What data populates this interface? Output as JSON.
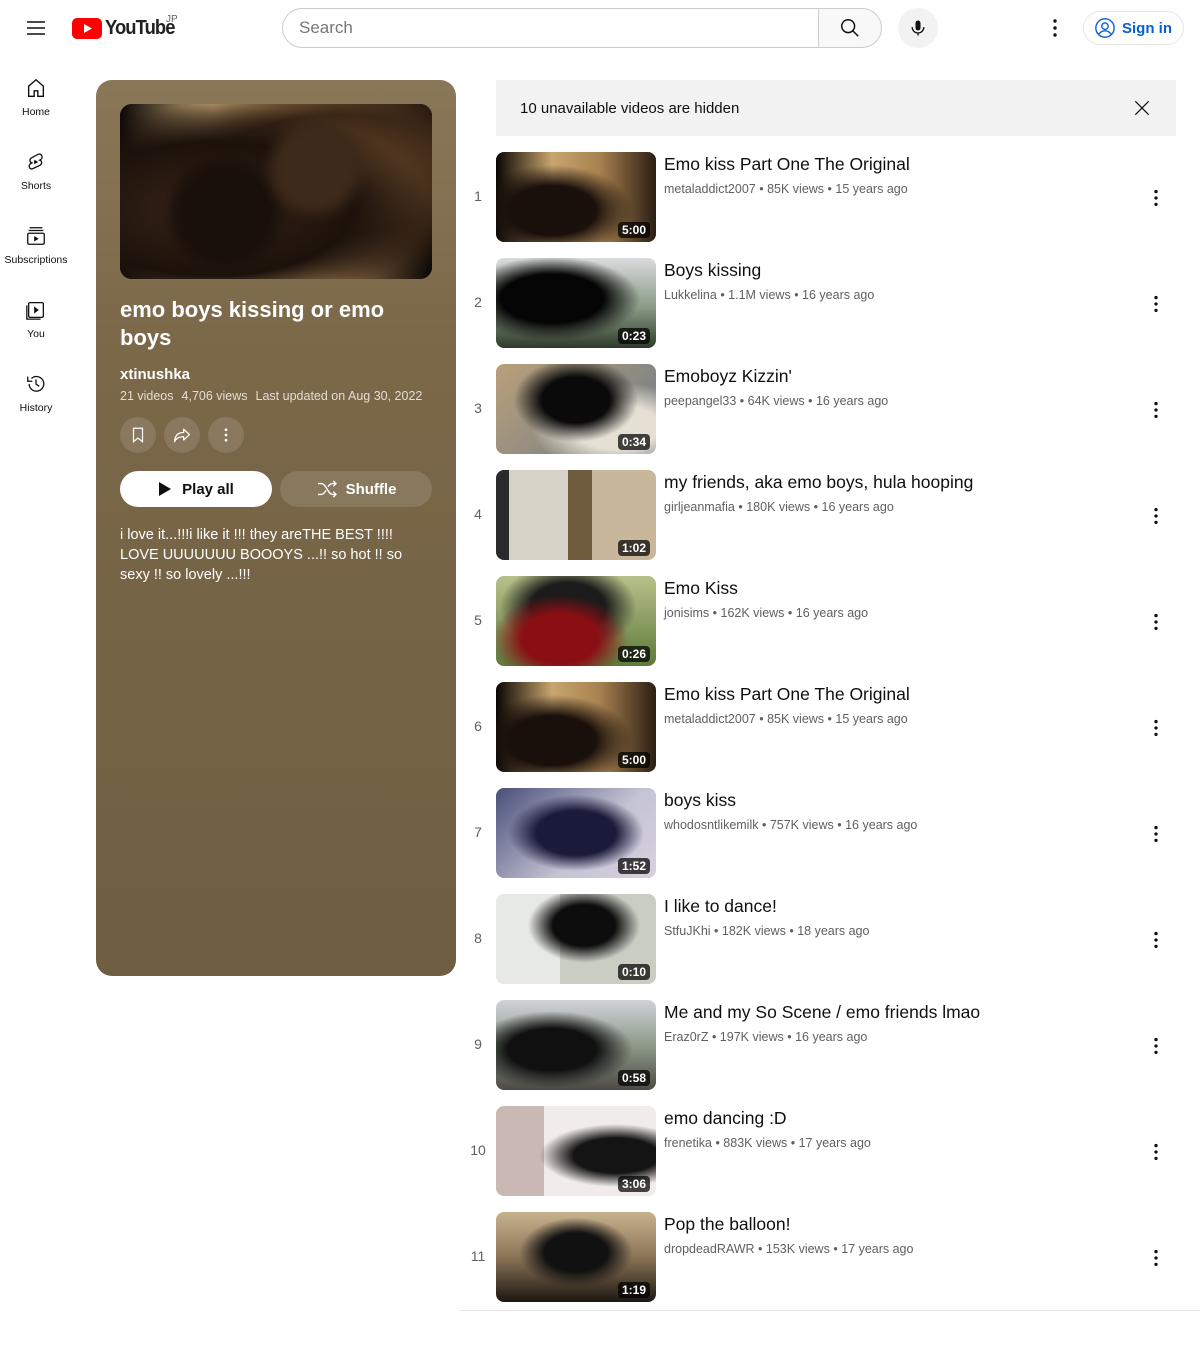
{
  "header": {
    "logo_text": "YouTube",
    "region": "JP",
    "search_placeholder": "Search",
    "signin_label": "Sign in"
  },
  "guide": {
    "items": [
      {
        "label": "Home",
        "icon": "home-icon"
      },
      {
        "label": "Shorts",
        "icon": "shorts-icon"
      },
      {
        "label": "Subscriptions",
        "icon": "subscriptions-icon"
      },
      {
        "label": "You",
        "icon": "you-icon"
      },
      {
        "label": "History",
        "icon": "history-icon"
      }
    ]
  },
  "playlist": {
    "title": "emo boys kissing or emo boys",
    "owner": "xtinushka",
    "video_count": "21 videos",
    "views": "4,706 views",
    "updated": "Last updated on Aug 30, 2022",
    "play_all_label": "Play all",
    "shuffle_label": "Shuffle",
    "description": "i love it...!!!i like it !!! they areTHE BEST !!!! LOVE UUUUUUU BOOOYS ...!! so hot !! so sexy !! so lovely ...!!!",
    "colors": {
      "card_top": "#8a7758",
      "card_bottom": "#6f5e42"
    }
  },
  "alert": {
    "text": "10 unavailable videos are hidden"
  },
  "videos": [
    {
      "index": "1",
      "title": "Emo kiss Part One The Original",
      "channel": "metaladdict2007",
      "views": "85K views",
      "age": "15 years ago",
      "duration": "5:00"
    },
    {
      "index": "2",
      "title": "Boys kissing",
      "channel": "Lukkelina",
      "views": "1.1M views",
      "age": "16 years ago",
      "duration": "0:23"
    },
    {
      "index": "3",
      "title": "Emoboyz Kizzin'",
      "channel": "peepangel33",
      "views": "64K views",
      "age": "16 years ago",
      "duration": "0:34"
    },
    {
      "index": "4",
      "title": "my friends, aka emo boys, hula hooping",
      "channel": "girljeanmafia",
      "views": "180K views",
      "age": "16 years ago",
      "duration": "1:02"
    },
    {
      "index": "5",
      "title": "Emo Kiss",
      "channel": "jonisims",
      "views": "162K views",
      "age": "16 years ago",
      "duration": "0:26"
    },
    {
      "index": "6",
      "title": "Emo kiss Part One The Original",
      "channel": "metaladdict2007",
      "views": "85K views",
      "age": "15 years ago",
      "duration": "5:00"
    },
    {
      "index": "7",
      "title": "boys kiss",
      "channel": "whodosntlikemilk",
      "views": "757K views",
      "age": "16 years ago",
      "duration": "1:52"
    },
    {
      "index": "8",
      "title": "I like to dance!",
      "channel": "StfuJKhi",
      "views": "182K views",
      "age": "18 years ago",
      "duration": "0:10"
    },
    {
      "index": "9",
      "title": "Me and my So Scene / emo friends lmao",
      "channel": "Eraz0rZ",
      "views": "197K views",
      "age": "16 years ago",
      "duration": "0:58"
    },
    {
      "index": "10",
      "title": "emo dancing :D",
      "channel": "frenetika",
      "views": "883K views",
      "age": "17 years ago",
      "duration": "3:06"
    },
    {
      "index": "11",
      "title": "Pop the balloon!",
      "channel": "dropdeadRAWR",
      "views": "153K views",
      "age": "17 years ago",
      "duration": "1:19"
    }
  ]
}
